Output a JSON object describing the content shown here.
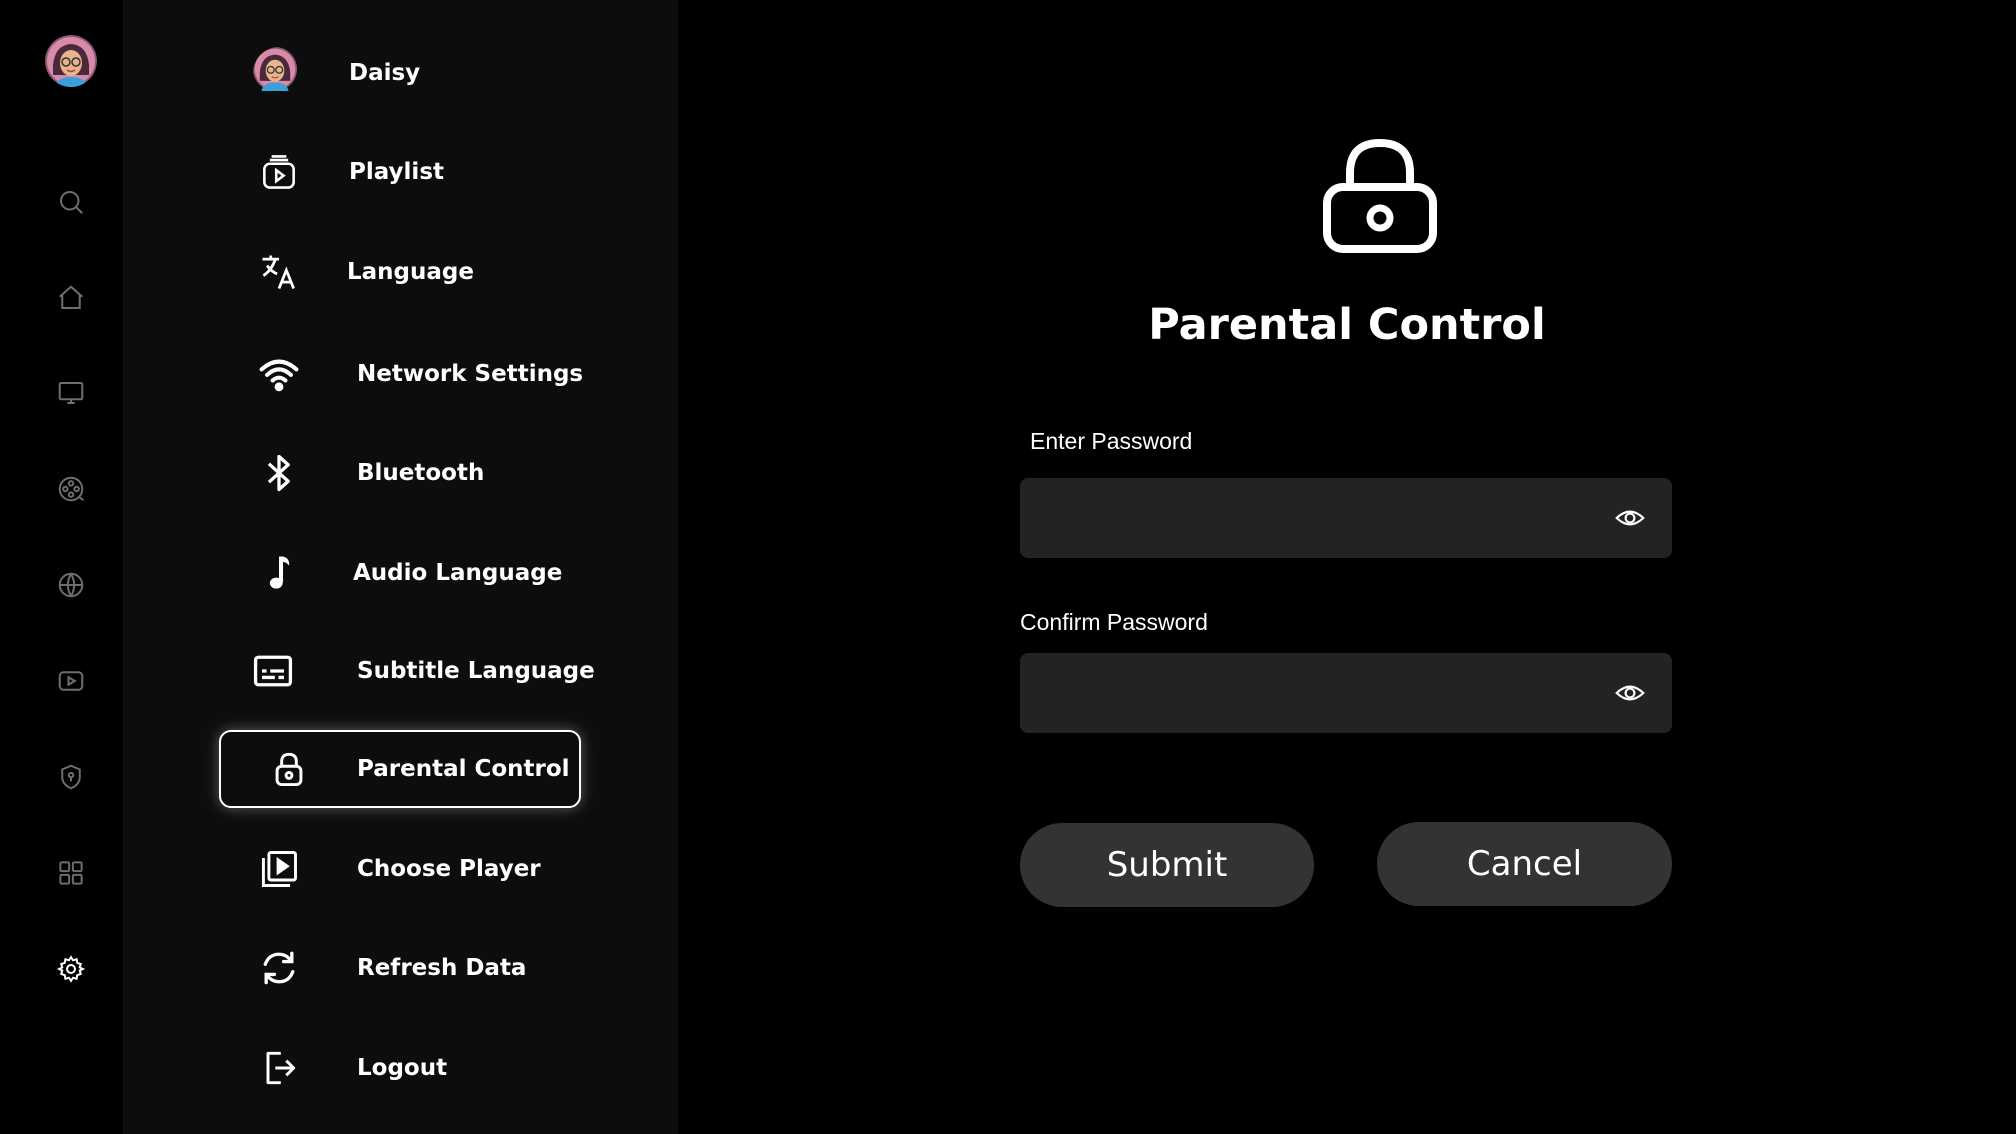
{
  "rail": {
    "icons": [
      "avatar",
      "search-icon",
      "home-icon",
      "tv-icon",
      "movies-icon",
      "sports-icon",
      "video-icon",
      "shield-icon",
      "grid-icon",
      "gear-icon"
    ]
  },
  "menu": {
    "items": [
      {
        "label": "Daisy",
        "icon": "avatar"
      },
      {
        "label": "Playlist",
        "icon": "playlist-icon"
      },
      {
        "label": "Language",
        "icon": "translate-icon"
      },
      {
        "label": "Network Settings",
        "icon": "wifi-icon"
      },
      {
        "label": "Bluetooth",
        "icon": "bluetooth-icon"
      },
      {
        "label": "Audio Language",
        "icon": "music-note-icon"
      },
      {
        "label": "Subtitle Language",
        "icon": "subtitles-icon"
      },
      {
        "label": "Parental Control",
        "icon": "lock-icon",
        "active": true
      },
      {
        "label": "Choose Player",
        "icon": "player-icon"
      },
      {
        "label": "Refresh Data",
        "icon": "refresh-icon"
      },
      {
        "label": "Logout",
        "icon": "logout-icon"
      }
    ]
  },
  "main": {
    "title": "Parental Control",
    "password": {
      "label": "Enter Password",
      "value": "",
      "placeholder": ""
    },
    "confirm": {
      "label": "Confirm Password",
      "value": "",
      "placeholder": ""
    },
    "submit_label": "Submit",
    "cancel_label": "Cancel"
  },
  "colors": {
    "background": "#000000",
    "panel": "#0d0d0d",
    "field": "#232323",
    "button": "#333333",
    "text": "#ffffff",
    "rail_icon": "#6e6e6e"
  }
}
